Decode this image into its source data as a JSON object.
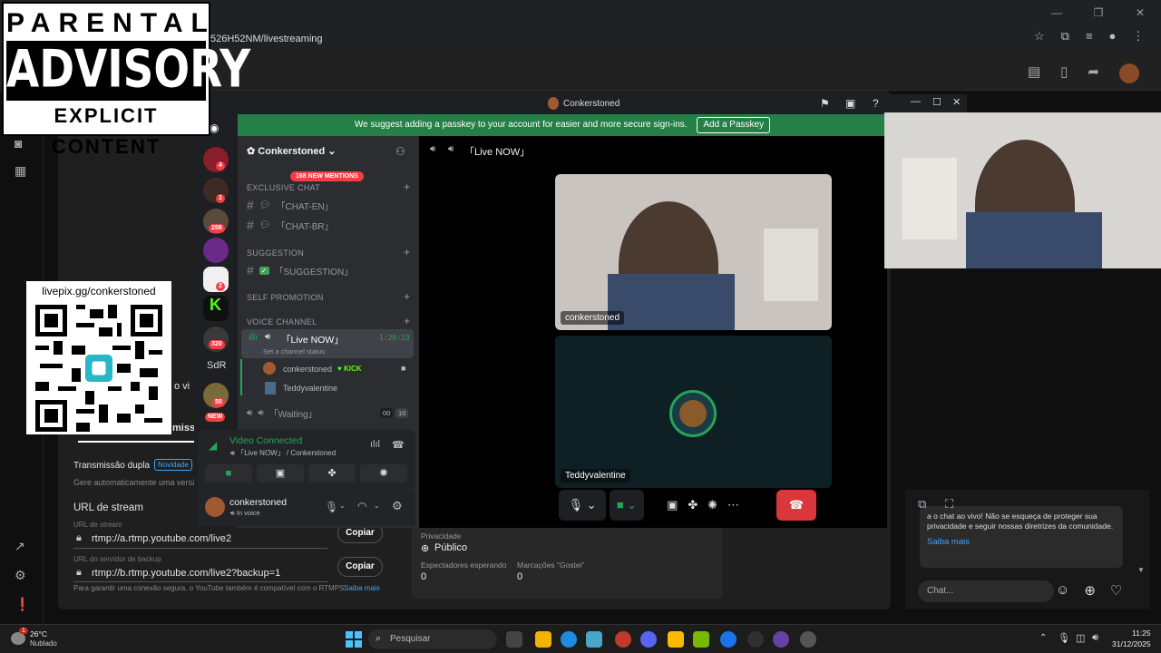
{
  "browser": {
    "url": "526H52NM/livestreaming",
    "win_ctrls": [
      "—",
      "❐",
      "✕"
    ]
  },
  "parental_advisory": {
    "top": "PARENTAL",
    "mid": "ADVISORY",
    "bot": "EXPLICIT CONTENT"
  },
  "qr": {
    "url": "livepix.gg/conkerstoned"
  },
  "youtube": {
    "partial_text_1": "o vi",
    "partial_text_2": "missã",
    "dual_stream": {
      "label": "Transmissão dupla",
      "badge": "Novidade",
      "desc": "Gere automaticamente uma versão v"
    },
    "stream_url": {
      "heading": "URL de stream",
      "url_label": "URL de stream",
      "url_value": "rtmp://a.rtmp.youtube.com/live2",
      "backup_label": "URL do servidor de backup",
      "backup_value": "rtmp://b.rtmp.youtube.com/live2?backup=1",
      "copy": "Copiar",
      "footer": "Para garantir uma conexão segura, o YouTube também é compatível com o RTMPS.",
      "learn_more": "Saiba mais"
    },
    "privacy": {
      "label": "Privacidade",
      "value": "Público"
    },
    "waiting": {
      "label": "Espectadores esperando",
      "value": "0"
    },
    "likes": {
      "label": "Marcações \"Gostei\"",
      "value": "0"
    }
  },
  "chat": {
    "message": "a o chat ao vivo! Não se esqueça de proteger sua privacidade e seguir nossas diretrizes da comunidade.",
    "learn_more": "Saiba mais",
    "placeholder": "Chat..."
  },
  "discord": {
    "title": "Conkerstoned",
    "banner": "We suggest adding a passkey to your account for easier and more secure sign-ins.",
    "banner_btn": "Add a Passkey",
    "server_name": "Conkerstoned",
    "mentions": "168 NEW MENTIONS",
    "server_badges": [
      "4",
      "1",
      "258",
      "2",
      "320",
      "50"
    ],
    "sdr": "SdR",
    "new": "NEW",
    "categories": {
      "exclusive": "EXCLUSIVE CHAT",
      "suggestion": "SUGGESTION",
      "self_promo": "SELF PROMOTION",
      "voice": "VOICE CHANNEL"
    },
    "channels": {
      "chat_en": "「CHAT-EN」",
      "chat_br": "「CHAT-BR」",
      "suggestion": "「SUGGESTION」"
    },
    "voice_live": {
      "name": "「Live NOW」",
      "timer": "1:20:23",
      "status": "Set a channel status"
    },
    "voice_users": [
      {
        "name": "conkerstoned",
        "tag": "KICK"
      },
      {
        "name": "Teddyvalentine"
      }
    ],
    "voice_waiting": {
      "name": "「Waiting」",
      "count_a": "00",
      "count_b": "10"
    },
    "vc": {
      "status": "Video Connected",
      "channel": "「Live NOW」 / Conkerstoned"
    },
    "user": {
      "name": "conkerstoned",
      "status": "In voice"
    },
    "main_header": "「Live NOW」",
    "tiles": [
      "conkerstoned",
      "Teddyvalentine"
    ]
  },
  "taskbar": {
    "weather_temp": "26°C",
    "weather_desc": "Nublado",
    "weather_badge": "1",
    "search": "Pesquisar",
    "time": "11:25",
    "date": "31/12/2025"
  }
}
